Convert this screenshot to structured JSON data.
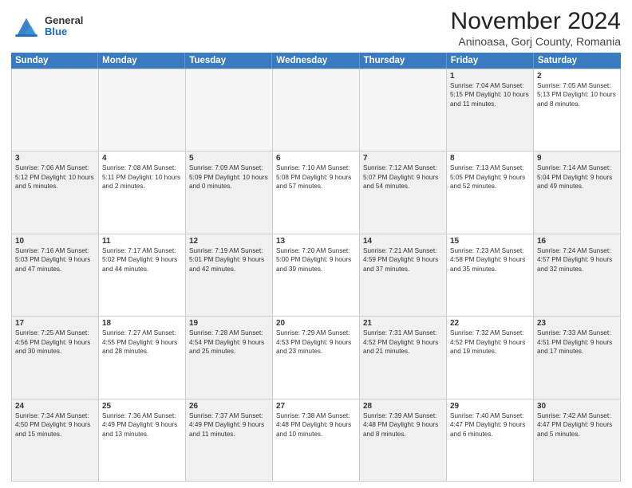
{
  "logo": {
    "general": "General",
    "blue": "Blue"
  },
  "title": "November 2024",
  "location": "Aninoasa, Gorj County, Romania",
  "header_days": [
    "Sunday",
    "Monday",
    "Tuesday",
    "Wednesday",
    "Thursday",
    "Friday",
    "Saturday"
  ],
  "weeks": [
    [
      {
        "day": "",
        "info": "",
        "empty": true
      },
      {
        "day": "",
        "info": "",
        "empty": true
      },
      {
        "day": "",
        "info": "",
        "empty": true
      },
      {
        "day": "",
        "info": "",
        "empty": true
      },
      {
        "day": "",
        "info": "",
        "empty": true
      },
      {
        "day": "1",
        "info": "Sunrise: 7:04 AM\nSunset: 5:15 PM\nDaylight: 10 hours and 11 minutes.",
        "shaded": true
      },
      {
        "day": "2",
        "info": "Sunrise: 7:05 AM\nSunset: 5:13 PM\nDaylight: 10 hours and 8 minutes.",
        "shaded": false
      }
    ],
    [
      {
        "day": "3",
        "info": "Sunrise: 7:06 AM\nSunset: 5:12 PM\nDaylight: 10 hours and 5 minutes.",
        "shaded": true
      },
      {
        "day": "4",
        "info": "Sunrise: 7:08 AM\nSunset: 5:11 PM\nDaylight: 10 hours and 2 minutes.",
        "shaded": false
      },
      {
        "day": "5",
        "info": "Sunrise: 7:09 AM\nSunset: 5:09 PM\nDaylight: 10 hours and 0 minutes.",
        "shaded": true
      },
      {
        "day": "6",
        "info": "Sunrise: 7:10 AM\nSunset: 5:08 PM\nDaylight: 9 hours and 57 minutes.",
        "shaded": false
      },
      {
        "day": "7",
        "info": "Sunrise: 7:12 AM\nSunset: 5:07 PM\nDaylight: 9 hours and 54 minutes.",
        "shaded": true
      },
      {
        "day": "8",
        "info": "Sunrise: 7:13 AM\nSunset: 5:05 PM\nDaylight: 9 hours and 52 minutes.",
        "shaded": false
      },
      {
        "day": "9",
        "info": "Sunrise: 7:14 AM\nSunset: 5:04 PM\nDaylight: 9 hours and 49 minutes.",
        "shaded": true
      }
    ],
    [
      {
        "day": "10",
        "info": "Sunrise: 7:16 AM\nSunset: 5:03 PM\nDaylight: 9 hours and 47 minutes.",
        "shaded": true
      },
      {
        "day": "11",
        "info": "Sunrise: 7:17 AM\nSunset: 5:02 PM\nDaylight: 9 hours and 44 minutes.",
        "shaded": false
      },
      {
        "day": "12",
        "info": "Sunrise: 7:19 AM\nSunset: 5:01 PM\nDaylight: 9 hours and 42 minutes.",
        "shaded": true
      },
      {
        "day": "13",
        "info": "Sunrise: 7:20 AM\nSunset: 5:00 PM\nDaylight: 9 hours and 39 minutes.",
        "shaded": false
      },
      {
        "day": "14",
        "info": "Sunrise: 7:21 AM\nSunset: 4:59 PM\nDaylight: 9 hours and 37 minutes.",
        "shaded": true
      },
      {
        "day": "15",
        "info": "Sunrise: 7:23 AM\nSunset: 4:58 PM\nDaylight: 9 hours and 35 minutes.",
        "shaded": false
      },
      {
        "day": "16",
        "info": "Sunrise: 7:24 AM\nSunset: 4:57 PM\nDaylight: 9 hours and 32 minutes.",
        "shaded": true
      }
    ],
    [
      {
        "day": "17",
        "info": "Sunrise: 7:25 AM\nSunset: 4:56 PM\nDaylight: 9 hours and 30 minutes.",
        "shaded": true
      },
      {
        "day": "18",
        "info": "Sunrise: 7:27 AM\nSunset: 4:55 PM\nDaylight: 9 hours and 28 minutes.",
        "shaded": false
      },
      {
        "day": "19",
        "info": "Sunrise: 7:28 AM\nSunset: 4:54 PM\nDaylight: 9 hours and 25 minutes.",
        "shaded": true
      },
      {
        "day": "20",
        "info": "Sunrise: 7:29 AM\nSunset: 4:53 PM\nDaylight: 9 hours and 23 minutes.",
        "shaded": false
      },
      {
        "day": "21",
        "info": "Sunrise: 7:31 AM\nSunset: 4:52 PM\nDaylight: 9 hours and 21 minutes.",
        "shaded": true
      },
      {
        "day": "22",
        "info": "Sunrise: 7:32 AM\nSunset: 4:52 PM\nDaylight: 9 hours and 19 minutes.",
        "shaded": false
      },
      {
        "day": "23",
        "info": "Sunrise: 7:33 AM\nSunset: 4:51 PM\nDaylight: 9 hours and 17 minutes.",
        "shaded": true
      }
    ],
    [
      {
        "day": "24",
        "info": "Sunrise: 7:34 AM\nSunset: 4:50 PM\nDaylight: 9 hours and 15 minutes.",
        "shaded": true
      },
      {
        "day": "25",
        "info": "Sunrise: 7:36 AM\nSunset: 4:49 PM\nDaylight: 9 hours and 13 minutes.",
        "shaded": false
      },
      {
        "day": "26",
        "info": "Sunrise: 7:37 AM\nSunset: 4:49 PM\nDaylight: 9 hours and 11 minutes.",
        "shaded": true
      },
      {
        "day": "27",
        "info": "Sunrise: 7:38 AM\nSunset: 4:48 PM\nDaylight: 9 hours and 10 minutes.",
        "shaded": false
      },
      {
        "day": "28",
        "info": "Sunrise: 7:39 AM\nSunset: 4:48 PM\nDaylight: 9 hours and 8 minutes.",
        "shaded": true
      },
      {
        "day": "29",
        "info": "Sunrise: 7:40 AM\nSunset: 4:47 PM\nDaylight: 9 hours and 6 minutes.",
        "shaded": false
      },
      {
        "day": "30",
        "info": "Sunrise: 7:42 AM\nSunset: 4:47 PM\nDaylight: 9 hours and 5 minutes.",
        "shaded": true
      }
    ]
  ]
}
